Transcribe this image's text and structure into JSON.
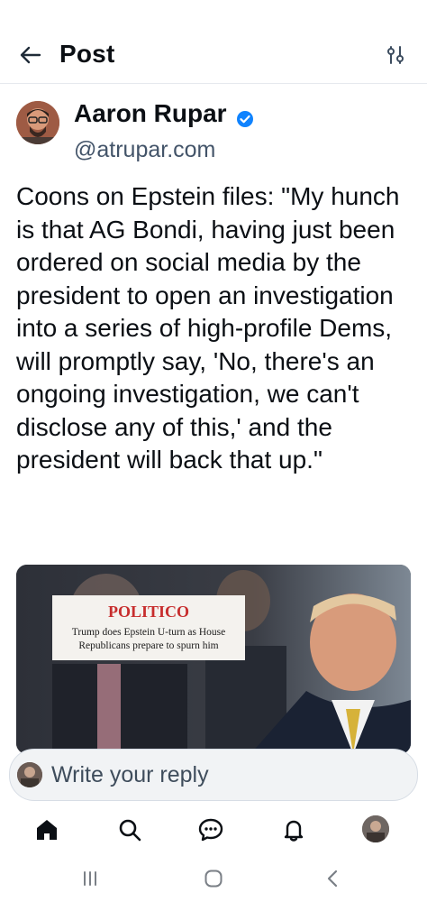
{
  "header": {
    "title": "Post"
  },
  "author": {
    "name": "Aaron Rupar",
    "handle": "@atrupar.com"
  },
  "post": {
    "text": "Coons on Epstein files: \"My hunch is that AG Bondi, having just been ordered on social media by the president to open an investigation into a series of high-profile Dems, will promptly say, 'No, there's an ongoing investigation, we can't disclose any of this,' and the president will back that up.\""
  },
  "media": {
    "logo": "POLITICO",
    "headline": "Trump does Epstein U-turn as House Republicans prepare to spurn him"
  },
  "reply": {
    "placeholder": "Write your reply"
  },
  "colors": {
    "accent": "#1083fe",
    "text": "#0b0f14",
    "muted": "#435469",
    "politico_red": "#c72d2d"
  },
  "icons": [
    "back-arrow-icon",
    "filter-icon",
    "verified-badge-icon",
    "home-icon",
    "search-icon",
    "chat-icon",
    "bell-icon",
    "recents-icon",
    "home-circle-icon",
    "back-chevron-icon"
  ]
}
